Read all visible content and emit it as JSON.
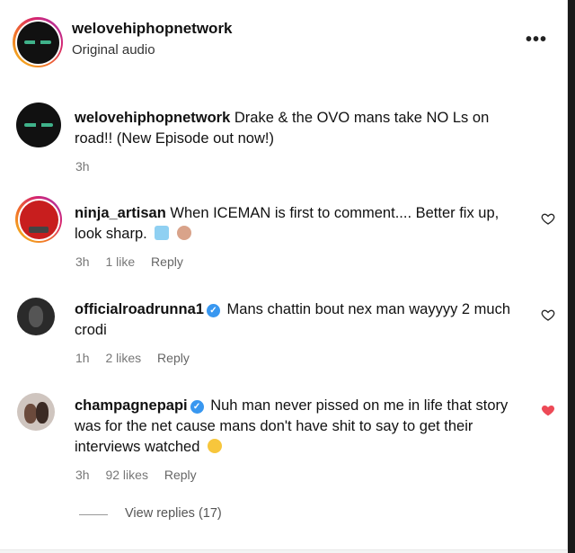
{
  "header": {
    "account": "welovehiphopnetwork",
    "subtitle": "Original audio",
    "more_icon": "more-horizontal-icon"
  },
  "comments": [
    {
      "username": "welovehiphopnetwork",
      "text": "Drake & the OVO mans take NO Ls on road!! (New Episode out now!)",
      "time": "3h",
      "likes": "",
      "reply": ""
    },
    {
      "username": "ninja_artisan",
      "text": "When ICEMAN is first to comment.... Better fix up, look sharp.",
      "time": "3h",
      "likes": "1 like",
      "reply": "Reply"
    },
    {
      "username": "officialroadrunna1",
      "text": "Mans chattin bout nex man wayyyy 2 much crodi",
      "time": "1h",
      "likes": "2 likes",
      "reply": "Reply"
    },
    {
      "username": "champagnepapi",
      "text": "Nuh man never pissed on me in life that story was for the net cause mans don't have shit to say to get their interviews watched",
      "time": "3h",
      "likes": "92 likes",
      "reply": "Reply"
    }
  ],
  "view_replies": "View replies (17)",
  "colors": {
    "verified": "#3897f0",
    "heart_liked": "#ed4956",
    "heart_outline": "#262626"
  }
}
